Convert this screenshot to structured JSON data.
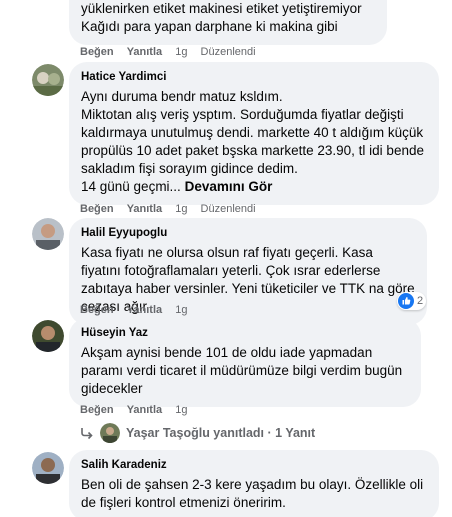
{
  "labels": {
    "like": "Beğen",
    "reply": "Yanıtla",
    "edited": "Düzenlendi"
  },
  "colors": {
    "bubble": "#f0f2f5",
    "meta": "#65676b",
    "like_blue": "#1877f2"
  },
  "comments": [
    {
      "author": "",
      "lines": "yüklenirken etiket makinesi etiket yetiştiremiyor\nKağıdı para yapan darphane ki makina gibi",
      "time": "1g",
      "edited": true
    },
    {
      "author": "Hatice Yardimci",
      "lines": "Aynı duruma bendr matuz ksldım.\nMiktotan alış veriş ysptım. Sorduğumda fiyatlar değişti kaldırmaya unutulmuş dendi. markette 40 t aldığım küçük propülüs 10 adet paket bşska markette 23.90, tl idi bende sakladım fişi sorayım gidince dedim.\n14 günü geçmi...",
      "more": "Devamını Gör",
      "time": "1g",
      "edited": true
    },
    {
      "author": "Halil Eyyupoglu",
      "lines": "Kasa fiyatı ne olursa olsun raf fiyatı geçerli. Kasa fiyatını fotoğraflamaları yeterli. Çok ısrar ederlerse zabıtaya haber versinler. Yeni tüketiciler ve TTK na göre cezası ağır",
      "reaction_count": "2",
      "time": "1g",
      "edited": false
    },
    {
      "author": "Hüseyin Yaz",
      "lines": "Akşam aynisi bende 101 de oldu iade yapmadan paramı verdi ticaret il müdürümüze bilgi verdim bugün gidecekler",
      "time": "1g",
      "edited": false,
      "replies": "Yaşar Taşoğlu yanıtladı · 1 Yanıt"
    },
    {
      "author": "Salih Karadeniz",
      "lines": "Ben oli de şahsen 2-3 kere yaşadım bu olayı. Özellikle oli de fişleri kontrol etmenizi öneririm."
    }
  ]
}
